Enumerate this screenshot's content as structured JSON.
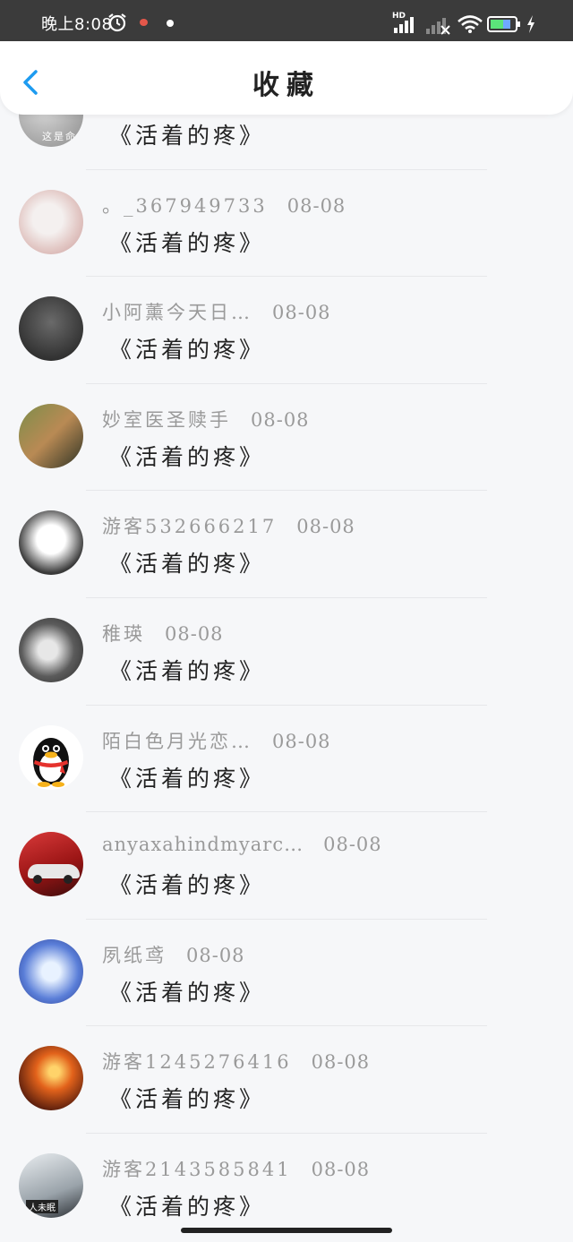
{
  "status_bar": {
    "time": "晚上8:08",
    "hd_label": "HD"
  },
  "header": {
    "title": "收藏"
  },
  "items": [
    {
      "name": "",
      "date": "",
      "title": "《活着的疼》",
      "avatar_text": "这是命"
    },
    {
      "name": "。_367949733",
      "date": "08-08",
      "title": "《活着的疼》"
    },
    {
      "name": "小阿薰今天日…",
      "date": "08-08",
      "title": "《活着的疼》"
    },
    {
      "name": "妙室医圣赎手",
      "date": "08-08",
      "title": "《活着的疼》"
    },
    {
      "name": "游客532666217",
      "date": "08-08",
      "title": "《活着的疼》"
    },
    {
      "name": "稚瑛",
      "date": "08-08",
      "title": "《活着的疼》"
    },
    {
      "name": "陌白色月光恋…",
      "date": "08-08",
      "title": "《活着的疼》"
    },
    {
      "name": "anyaxahindmyarc…",
      "date": "08-08",
      "title": "《活着的疼》"
    },
    {
      "name": "夙纸鸢",
      "date": "08-08",
      "title": "《活着的疼》"
    },
    {
      "name": "游客1245276416",
      "date": "08-08",
      "title": "《活着的疼》"
    },
    {
      "name": "游客2143585841",
      "date": "08-08",
      "title": "《活着的疼》",
      "avatar_text": "人未眠"
    }
  ],
  "colors": {
    "accent": "#1d9bf0",
    "header_bg": "#ffffff",
    "page_bg": "#f6f7f9",
    "meta_text": "#9a9a9a",
    "title_text": "#222222"
  },
  "icons": {
    "back": "chevron-left-icon",
    "alarm": "alarm-clock-icon",
    "wifi": "wifi-icon",
    "battery": "battery-icon",
    "charging": "bolt-icon"
  }
}
